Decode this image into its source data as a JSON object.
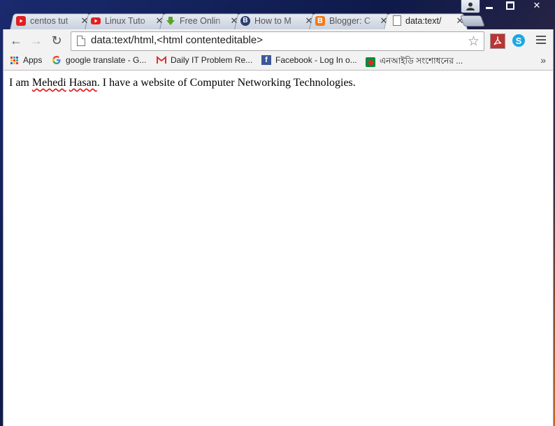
{
  "tabs": [
    {
      "title": "centos tut",
      "favicon": "youtube-icon",
      "color": "#e02020"
    },
    {
      "title": "Linux Tuto",
      "favicon": "youtube-icon",
      "color": "#e02020"
    },
    {
      "title": "Free Onlin",
      "favicon": "download-arrow-icon",
      "color": "#5aa02c"
    },
    {
      "title": "How to M",
      "favicon": "b-logo-icon",
      "color": "#2c3e6e"
    },
    {
      "title": "Blogger: C",
      "favicon": "blogger-icon",
      "color": "#f07a1a"
    },
    {
      "title": "data:text/",
      "favicon": "page-icon",
      "color": "#888888"
    }
  ],
  "toolbar": {
    "url": "data:text/html,<html contenteditable>",
    "back_icon": "←",
    "forward_icon": "→",
    "reload_icon": "↻",
    "star_icon": "☆",
    "pdf_icon": "pdf-extension-icon",
    "skype_label": "S"
  },
  "window": {
    "close_label": "✕"
  },
  "bookmarks": [
    {
      "label": "Apps",
      "icon": "apps-grid-icon"
    },
    {
      "label": "google translate - G...",
      "icon": "google-icon"
    },
    {
      "label": "Daily IT Problem Re...",
      "icon": "gmail-icon"
    },
    {
      "label": "Facebook - Log In o...",
      "icon": "facebook-icon"
    },
    {
      "label": "এনআইডি  সংশোধনের  ...",
      "icon": "bangladesh-flag-icon"
    }
  ],
  "bookmarks_more": "»",
  "page": {
    "text_before": "I am ",
    "word1": "Mehedi",
    "space": " ",
    "word2": "Hasan",
    "text_after": ". I have a website of Computer Networking Technologies."
  }
}
